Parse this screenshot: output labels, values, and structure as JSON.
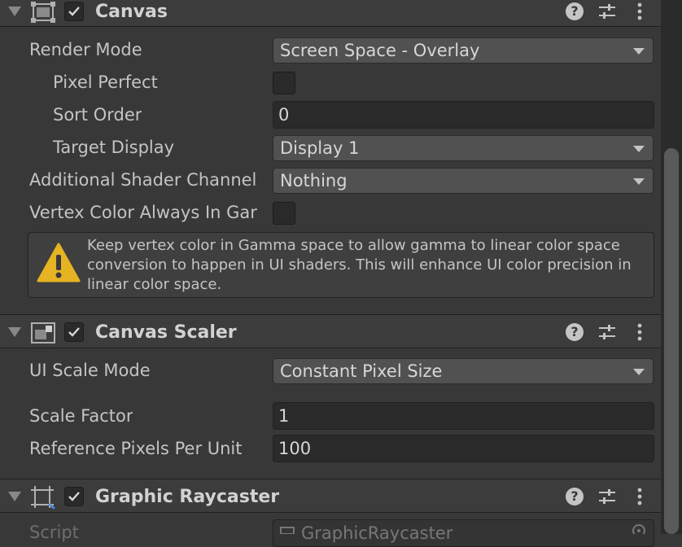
{
  "canvas": {
    "title": "Canvas",
    "fields": {
      "render_mode_label": "Render Mode",
      "render_mode_value": "Screen Space - Overlay",
      "pixel_perfect_label": "Pixel Perfect",
      "sort_order_label": "Sort Order",
      "sort_order_value": "0",
      "target_display_label": "Target Display",
      "target_display_value": "Display 1",
      "additional_shader_label": "Additional Shader Channel",
      "additional_shader_value": "Nothing",
      "vertex_color_label": "Vertex Color Always In Gar"
    },
    "warning_text": "Keep vertex color in Gamma space to allow gamma to linear color space conversion to happen in UI shaders. This will enhance UI color precision in linear color space."
  },
  "canvas_scaler": {
    "title": "Canvas Scaler",
    "fields": {
      "ui_scale_mode_label": "UI Scale Mode",
      "ui_scale_mode_value": "Constant Pixel Size",
      "scale_factor_label": "Scale Factor",
      "scale_factor_value": "1",
      "ref_pixels_label": "Reference Pixels Per Unit",
      "ref_pixels_value": "100"
    }
  },
  "graphic_raycaster": {
    "title": "Graphic Raycaster",
    "script_label": "Script",
    "script_value": "GraphicRaycaster"
  },
  "icons": {
    "help": "help-icon",
    "presets": "sliders-icon",
    "menu": "kebab-menu-icon",
    "warning": "warning-icon"
  },
  "colors": {
    "background": "#383838",
    "header": "#3c3c3c",
    "dropdown": "#515151",
    "field": "#2a2a2a",
    "warning": "#e6b422"
  },
  "help_glyph": "?"
}
